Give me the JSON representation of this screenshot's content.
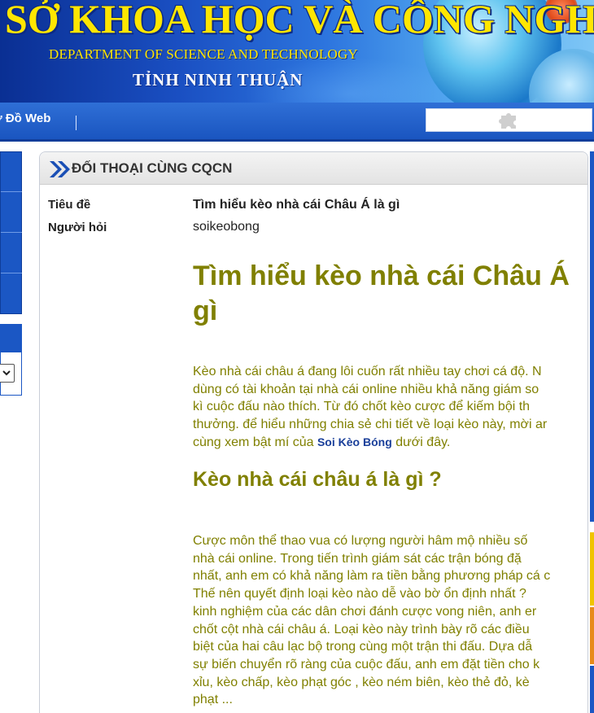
{
  "banner": {
    "title": "SỞ KHOA HỌC VÀ CÔNG NGHỆ",
    "subtitle": "DEPARTMENT OF SCIENCE AND TECHNOLOGY",
    "province": "TỈNH NINH THUẬN"
  },
  "nav": {
    "sitemap_label": "ơ Đồ Web",
    "plugin_icon": "puzzle-piece-icon"
  },
  "panel": {
    "heading": "ĐỐI THOẠI CÙNG CQCN",
    "title_label": "Tiêu đề",
    "title_value": "Tìm hiểu kèo nhà cái Châu Á là gì",
    "asker_label": "Người hỏi",
    "asker_value": "soikeobong"
  },
  "article": {
    "heading_line1": "Tìm hiểu kèo nhà cái Châu Á",
    "heading_line2": "gì",
    "intro_lines": [
      "Kèo nhà cái châu á đang lôi cuốn rất nhiều tay chơi cá độ. N",
      "dùng có tài khoản tại nhà cái online nhiều khả năng giám so",
      "kì cuộc đấu nào thích. Từ đó chốt kèo cược để kiếm bội th",
      "thưởng. để hiểu những chia sẻ chi tiết về loại kèo này, mời ar"
    ],
    "intro_last_before": "cùng xem bật mí của ",
    "intro_link": "Soi Kèo Bóng",
    "intro_last_after": " dưới đây.",
    "subheading": "Kèo nhà cái châu á là gì ?",
    "body_lines": [
      "Cược môn thể thao vua có lượng người hâm mộ nhiều số",
      "nhà cái online. Trong tiến trình giám sát các trận bóng đặ",
      "nhất, anh em có khả năng làm ra tiền bằng phương pháp cá c",
      "Thế nên quyết định loại kèo nào dễ vào bờ ổn định nhất ?",
      "kinh nghiệm của các dân chơi đánh cược vong niên, anh er",
      "chốt cột nhà cái châu á. Loại kèo này trình bày rõ các điều",
      "biệt của hai câu lạc bộ trong cùng một trận thi đấu. Dựa dẫ",
      "sự biến chuyển rõ ràng của cuộc đấu, anh em đặt tiền cho k",
      "xỉu, kèo chấp, kèo phạt góc , kèo ném biên, kèo thẻ đỏ, kè",
      "phạt ..."
    ]
  },
  "colors": {
    "accent_olive": "#808000",
    "nav_blue": "#1a55c0",
    "banner_yellow": "#ffe600",
    "link_blue": "#1a3f9a"
  }
}
